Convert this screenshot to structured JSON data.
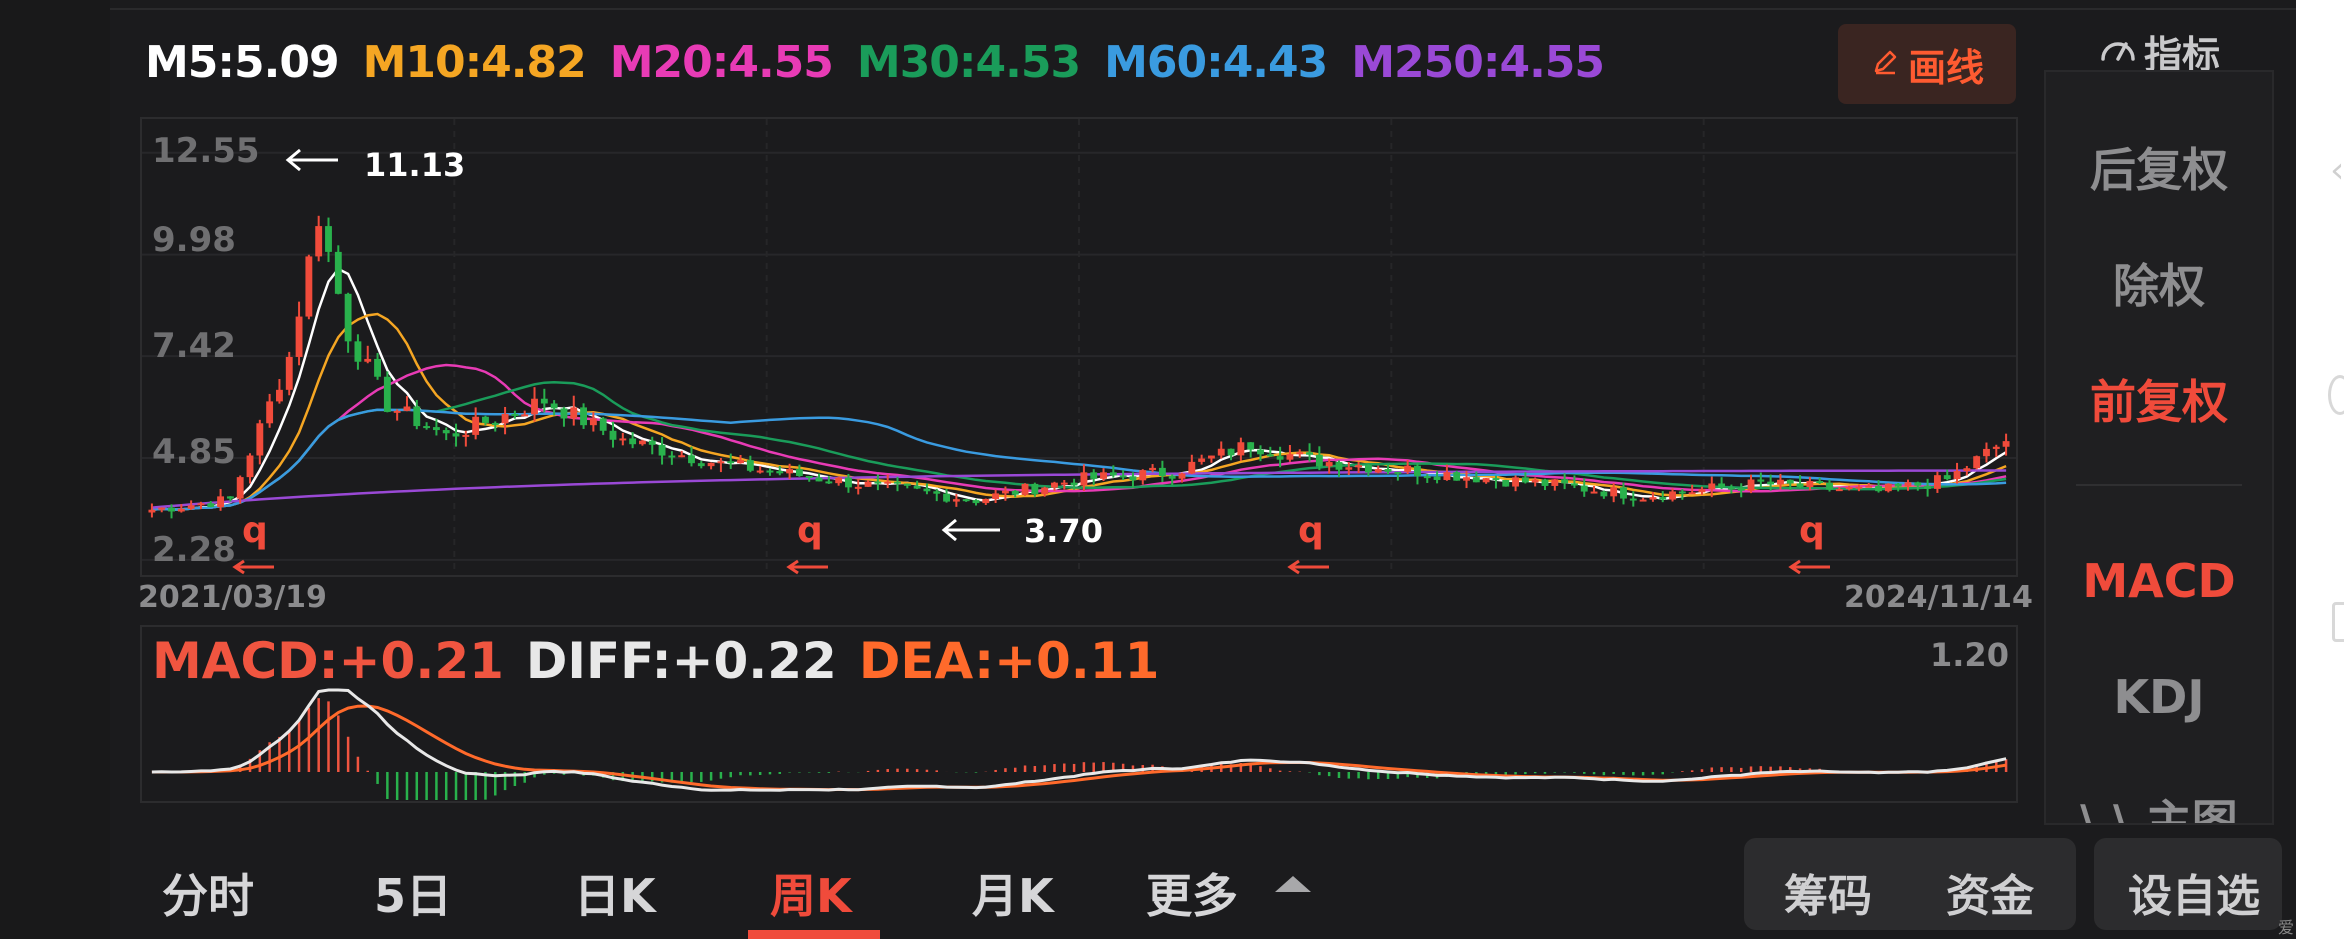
{
  "ma_legend": [
    {
      "label": "M5:5.09",
      "color": "#ffffff"
    },
    {
      "label": "M10:4.82",
      "color": "#f5a623"
    },
    {
      "label": "M20:4.55",
      "color": "#e83bb5"
    },
    {
      "label": "M30:4.53",
      "color": "#1a9c5a"
    },
    {
      "label": "M60:4.43",
      "color": "#3a9be0"
    },
    {
      "label": "M250:4.55",
      "color": "#9a49d6"
    }
  ],
  "draw_button": {
    "label": "画线",
    "icon": "pencil-icon"
  },
  "indicator_header": {
    "label": "指标",
    "icon": "gauge-icon"
  },
  "side_menu": [
    {
      "label": "后复权",
      "active": false
    },
    {
      "label": "除权",
      "active": false
    },
    {
      "label": "前复权",
      "active": true
    },
    {
      "label": "MACD",
      "active": true
    },
    {
      "label": "KDJ",
      "active": false
    },
    {
      "label": "\\ \\ 主图",
      "active": false
    }
  ],
  "price_axis": {
    "ticks": [
      "12.55",
      "9.98",
      "7.42",
      "4.85",
      "2.28"
    ]
  },
  "dates": {
    "start": "2021/03/19",
    "end": "2024/11/14"
  },
  "annotations": {
    "high": "11.13",
    "low": "3.70",
    "marker": "q"
  },
  "macd": {
    "macd_label": "MACD:+0.21",
    "diff_label": "DIFF:+0.22",
    "dea_label": "DEA:+0.11",
    "axis_top": "1.20",
    "colors": {
      "macd": "#f05540",
      "diff": "#e8e8e8",
      "dea": "#ff6a2b"
    }
  },
  "tabs": [
    {
      "label": "分时",
      "active": false
    },
    {
      "label": "5日",
      "active": false
    },
    {
      "label": "日K",
      "active": false
    },
    {
      "label": "周K",
      "active": true
    },
    {
      "label": "月K",
      "active": false
    },
    {
      "label": "更多",
      "active": false
    }
  ],
  "bottom_buttons": {
    "chips": "筹码",
    "funds": "资金",
    "watchlist": "设自选"
  },
  "edge_text": "爱",
  "colors": {
    "up": "#f04b3b",
    "down": "#29b14c",
    "accent": "#ff5b31",
    "background": "#1b1b1d"
  }
}
